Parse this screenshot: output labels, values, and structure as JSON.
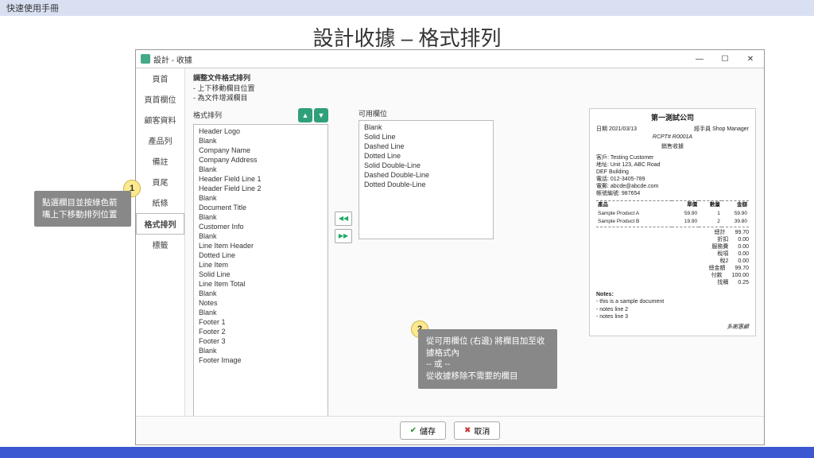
{
  "header": {
    "title": "快速使用手冊"
  },
  "page": {
    "title": "設計收據 – 格式排列"
  },
  "window": {
    "title": "設計 - 收據",
    "sidebar": {
      "items": [
        {
          "label": "頁首"
        },
        {
          "label": "頁首欄位"
        },
        {
          "label": "顧客資料"
        },
        {
          "label": "產品列"
        },
        {
          "label": "備註"
        },
        {
          "label": "頁尾"
        },
        {
          "label": "紙條"
        },
        {
          "label": "格式排列"
        },
        {
          "label": "標籤"
        }
      ],
      "active_index": 7
    },
    "instructions": {
      "line1": "調整文件格式排列",
      "line2": "- 上下移動欄目位置",
      "line3": "- 為文件增減欄目"
    },
    "list1": {
      "label": "格式排列",
      "items": [
        "Header Logo",
        "Blank",
        "Company Name",
        "Company Address",
        "Blank",
        "Header Field Line 1",
        "Header Field Line 2",
        "Blank",
        "Document Title",
        "Blank",
        "Customer Info",
        "Blank",
        "Line Item Header",
        "Dotted Line",
        "Line Item",
        "Solid Line",
        "Line Item Total",
        "Blank",
        "Notes",
        "Blank",
        "Footer 1",
        "Footer 2",
        "Footer 3",
        "Blank",
        "Footer Image"
      ]
    },
    "list2": {
      "label": "可用欄位",
      "items": [
        "Blank",
        "Solid Line",
        "Dashed Line",
        "Dotted Line",
        "Solid Double-Line",
        "Dashed Double-Line",
        "Dotted Double-Line"
      ]
    },
    "buttons": {
      "save": "儲存",
      "cancel": "取消"
    }
  },
  "preview": {
    "company": "第一測試公司",
    "date_label": "日期",
    "date": "2021/03/13",
    "staff_label": "經手員",
    "staff": "Shop Manager",
    "docno": "RCPT# R0001A",
    "subtitle": "銷售收據",
    "cust_label": "客戶:",
    "cust": "Testing Customer",
    "addr_label": "地址:",
    "addr1": "Unit 123, ABC Road",
    "addr2": "DEF Building",
    "tel_label": "電話:",
    "tel": "012-3405-789",
    "email_label": "電郵:",
    "email": "abcde@abcde.com",
    "acct_label": "帳號編號:",
    "acct": "987654",
    "th": [
      "產品",
      "單價",
      "數量",
      "金額"
    ],
    "rows": [
      {
        "name": "Sample Product A",
        "price": "59.90",
        "qty": "1",
        "amt": "59.90"
      },
      {
        "name": "Sample Product B",
        "price": "19.90",
        "qty": "2",
        "amt": "39.80"
      }
    ],
    "totals": [
      {
        "k": "總計",
        "v": "99.70"
      },
      {
        "k": "折扣",
        "v": "0.00"
      },
      {
        "k": "服務費",
        "v": "0.00"
      },
      {
        "k": "稅項",
        "v": "0.00"
      },
      {
        "k": "稅2",
        "v": "0.00"
      },
      {
        "k": "總金額",
        "v": "99.70"
      },
      {
        "k": "付款",
        "v": "100.00"
      },
      {
        "k": "找贖",
        "v": "0.25"
      }
    ],
    "notes_title": "Notes:",
    "notes": [
      "- this is a sample document",
      "- notes line 2",
      "- notes line 3"
    ],
    "thank": "多謝惠顧"
  },
  "callouts": {
    "c1": {
      "num": "1",
      "text": "點選欄目並按綠色箭嘴上下移動排列位置"
    },
    "c2": {
      "num": "2",
      "line1": "從可用欄位 (右邊) 將欄目加至收據格式內",
      "line2": "-- 或 --",
      "line3": "從收據移除不需要的欄目"
    }
  }
}
